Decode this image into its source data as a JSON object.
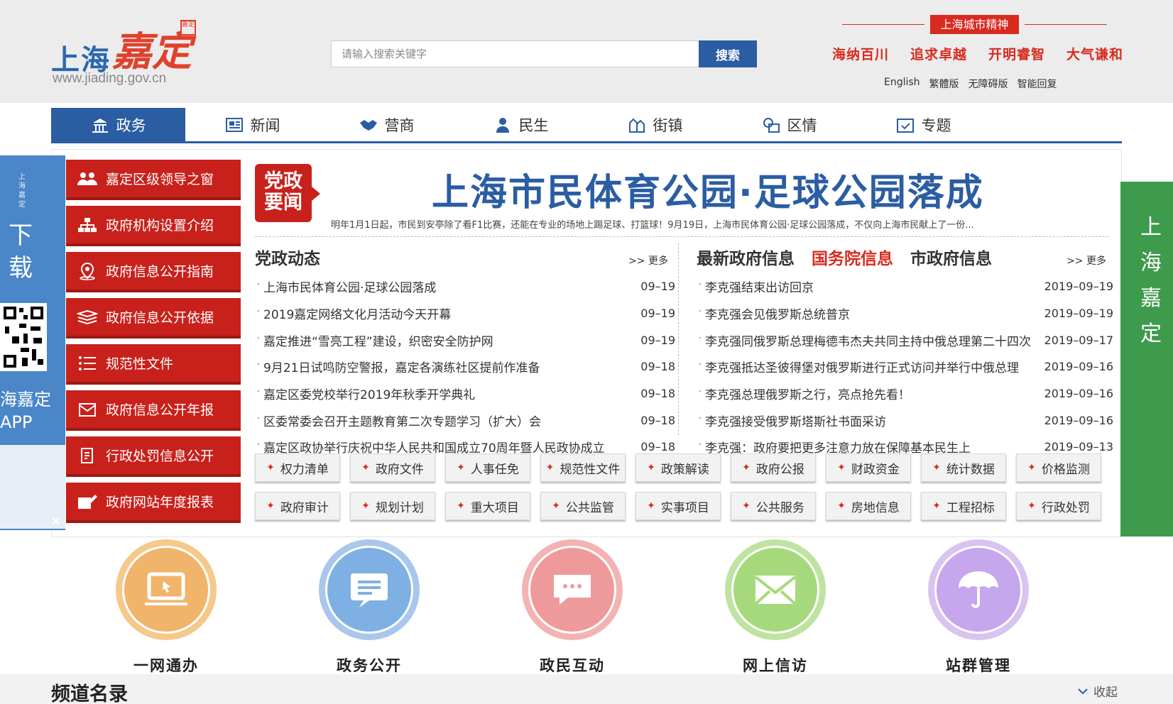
{
  "header": {
    "logo_text": "上海",
    "logo_brand": "嘉定",
    "logo_seal": "嘉定",
    "logo_url": "www.jiading.gov.cn",
    "search_placeholder": "请输入搜索关键字",
    "search_button": "搜索",
    "spirit_tag": "上海城市精神",
    "mottos": [
      "海纳百川",
      "追求卓越",
      "开明睿智",
      "大气谦和"
    ],
    "lang_links": [
      "English",
      "繁體版",
      "无障碍版",
      "智能回复"
    ]
  },
  "nav": {
    "items": [
      {
        "label": "政务",
        "icon": "government-building-icon",
        "active": true
      },
      {
        "label": "新闻",
        "icon": "newspaper-icon"
      },
      {
        "label": "营商",
        "icon": "handshake-icon"
      },
      {
        "label": "民生",
        "icon": "person-icon"
      },
      {
        "label": "街镇",
        "icon": "town-icon"
      },
      {
        "label": "区情",
        "icon": "district-info-icon"
      },
      {
        "label": "专题",
        "icon": "calendar-check-icon"
      }
    ]
  },
  "left_ad": {
    "vertical_small": "上海嘉定",
    "download_text": "下载",
    "app_name": "海嘉定APP",
    "close": "×"
  },
  "right_ad": {
    "vertical_text": "上海嘉定"
  },
  "sidebar": {
    "items": [
      {
        "label": "嘉定区级领导之窗",
        "icon": "people-icon"
      },
      {
        "label": "政府机构设置介绍",
        "icon": "org-chart-icon"
      },
      {
        "label": "政府信息公开指南",
        "icon": "location-pin-icon"
      },
      {
        "label": "政府信息公开依据",
        "icon": "books-icon"
      },
      {
        "label": "规范性文件",
        "icon": "list-icon"
      },
      {
        "label": "政府信息公开年报",
        "icon": "envelope-icon"
      },
      {
        "label": "行政处罚信息公开",
        "icon": "document-icon"
      },
      {
        "label": "政府网站年度报表",
        "icon": "report-icon"
      }
    ]
  },
  "headline": {
    "badge": "党政要闻",
    "title": "上海市民体育公园·足球公园落成",
    "summary": "明年1月1日起，市民到安亭除了看F1比赛，还能在专业的场地上踢足球、打篮球！9月19日，上海市民体育公园·足球公园落成，不仅向上海市民献上了一份..."
  },
  "party_news": {
    "title": "党政动态",
    "more": ">> 更多",
    "items": [
      {
        "title": "上海市民体育公园·足球公园落成",
        "date": "09–19"
      },
      {
        "title": "2019嘉定网络文化月活动今天开幕",
        "date": "09–19"
      },
      {
        "title": "嘉定推进“雪亮工程”建设，织密安全防护网",
        "date": "09–19"
      },
      {
        "title": "9月21日试鸣防空警报，嘉定各演练社区提前作准备",
        "date": "09–18"
      },
      {
        "title": "嘉定区委党校举行2019年秋季开学典礼",
        "date": "09–18"
      },
      {
        "title": "区委常委会召开主题教育第二次专题学习（扩大）会",
        "date": "09–18"
      },
      {
        "title": "嘉定区政协举行庆祝中华人民共和国成立70周年暨人民政协成立",
        "date": "09–18"
      }
    ]
  },
  "gov_info": {
    "tabs": [
      {
        "label": "最新政府信息",
        "active": false
      },
      {
        "label": "国务院信息",
        "active": true
      },
      {
        "label": "市政府信息",
        "active": false
      }
    ],
    "more": ">> 更多",
    "items": [
      {
        "title": "李克强结束出访回京",
        "date": "2019–09–19"
      },
      {
        "title": "李克强会见俄罗斯总统普京",
        "date": "2019–09–19"
      },
      {
        "title": "李克强同俄罗斯总理梅德韦杰夫共同主持中俄总理第二十四次",
        "date": "2019–09–17"
      },
      {
        "title": "李克强抵达圣彼得堡对俄罗斯进行正式访问并举行中俄总理",
        "date": "2019–09–16"
      },
      {
        "title": "李克强总理俄罗斯之行，亮点抢先看！",
        "date": "2019–09–16"
      },
      {
        "title": "李克强接受俄罗斯塔斯社书面采访",
        "date": "2019–09–16"
      },
      {
        "title": "李克强：政府要把更多注意力放在保障基本民生上",
        "date": "2019–09–13"
      }
    ]
  },
  "quick_buttons": [
    "权力清单",
    "政府文件",
    "人事任免",
    "规范性文件",
    "政策解读",
    "政府公报",
    "财政资金",
    "统计数据",
    "价格监测",
    "政府审计",
    "规划计划",
    "重大项目",
    "公共监管",
    "实事项目",
    "公共服务",
    "房地信息",
    "工程招标",
    "行政处罚"
  ],
  "services": [
    {
      "label": "一网通办",
      "icon": "laptop-icon",
      "ring": "#f5c98a",
      "fill": "#f0b46a"
    },
    {
      "label": "政务公开",
      "icon": "document-screen-icon",
      "ring": "#a9c7ea",
      "fill": "#7fb0e3"
    },
    {
      "label": "政民互动",
      "icon": "chat-bubble-icon",
      "ring": "#f3b3b3",
      "fill": "#ef9a9a"
    },
    {
      "label": "网上信访",
      "icon": "mail-icon",
      "ring": "#bfe3a0",
      "fill": "#a6d97b"
    },
    {
      "label": "站群管理",
      "icon": "umbrella-icon",
      "ring": "#d9c3f0",
      "fill": "#c6a6ec"
    }
  ],
  "bottom": {
    "title": "频道名录",
    "collapse": "收起"
  },
  "colors": {
    "brand_blue": "#2b5da3",
    "brand_red": "#c8211c"
  }
}
